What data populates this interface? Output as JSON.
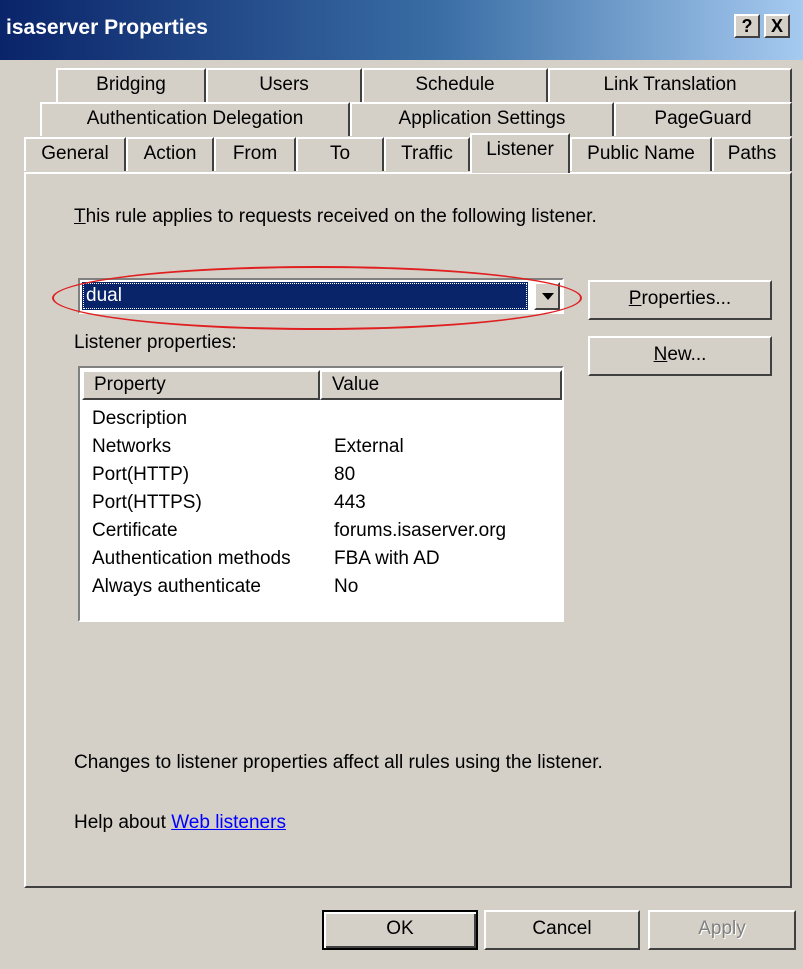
{
  "window": {
    "title": "isaserver Properties",
    "help_button": "?",
    "close_button": "X"
  },
  "tabs": {
    "row1": [
      "Bridging",
      "Users",
      "Schedule",
      "Link Translation"
    ],
    "row2": [
      "Authentication Delegation",
      "Application Settings",
      "PageGuard"
    ],
    "row3": [
      "General",
      "Action",
      "From",
      "To",
      "Traffic",
      "Listener",
      "Public Name",
      "Paths"
    ],
    "active": "Listener"
  },
  "listener": {
    "intro_prefix": "T",
    "intro_rest": "his rule applies to requests received on the following listener.",
    "selected": "dual",
    "properties_button_prefix": "P",
    "properties_button_rest": "roperties...",
    "new_button_prefix": "N",
    "new_button_rest": "ew...",
    "list_label": "Listener properties:",
    "columns": [
      "Property",
      "Value"
    ],
    "rows": [
      [
        "Description",
        ""
      ],
      [
        "Networks",
        "External"
      ],
      [
        "Port(HTTP)",
        "80"
      ],
      [
        "Port(HTTPS)",
        "443"
      ],
      [
        "Certificate",
        "forums.isaserver.org"
      ],
      [
        "Authentication methods",
        "FBA with AD"
      ],
      [
        "Always authenticate",
        "No"
      ]
    ],
    "note": "Changes to listener properties affect all rules using the listener.",
    "help_prefix": "Help about ",
    "help_link": "Web listeners"
  },
  "footer": {
    "ok": "OK",
    "cancel": "Cancel",
    "apply": "Apply"
  }
}
